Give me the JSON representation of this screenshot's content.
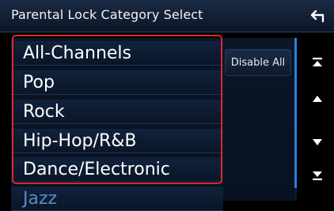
{
  "header": {
    "title": "Parental Lock Category Select"
  },
  "list": {
    "items": [
      {
        "label": "All-Channels"
      },
      {
        "label": "Pop"
      },
      {
        "label": "Rock"
      },
      {
        "label": "Hip-Hop/R&B"
      },
      {
        "label": "Dance/Electronic"
      },
      {
        "label": "Jazz"
      }
    ]
  },
  "actions": {
    "disable_all_label": "Disable All"
  },
  "icons": {
    "back": "back-arrow-icon",
    "scroll_top": "scroll-to-top-icon",
    "scroll_up": "scroll-up-icon",
    "scroll_down": "scroll-down-icon",
    "scroll_bottom": "scroll-to-bottom-icon"
  },
  "colors": {
    "highlight_border": "#e0242a",
    "accent_blue": "#2a7fe0",
    "background": "#000000"
  }
}
